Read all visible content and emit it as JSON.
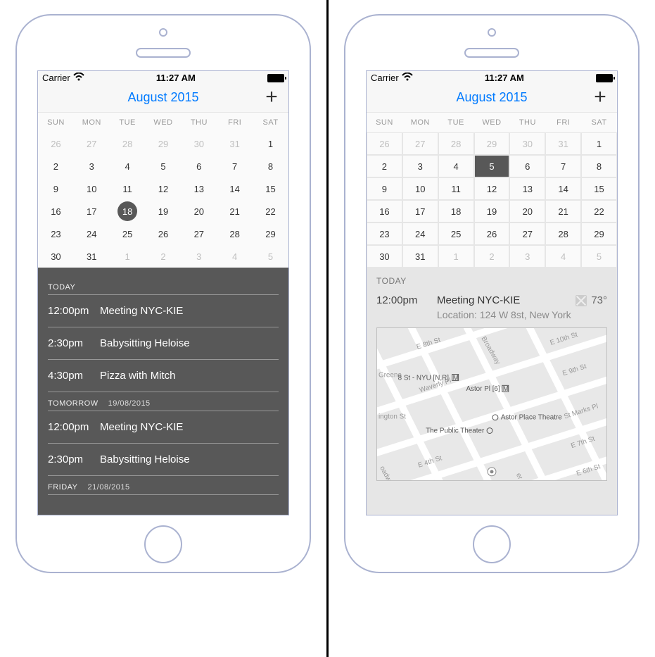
{
  "statusbar": {
    "carrier": "Carrier",
    "time": "11:27 AM"
  },
  "header": {
    "title": "August 2015"
  },
  "weekdays": [
    "SUN",
    "MON",
    "TUE",
    "WED",
    "THU",
    "FRI",
    "SAT"
  ],
  "calendar_left": {
    "selected_day": 18,
    "days": [
      {
        "n": 26,
        "other": true
      },
      {
        "n": 27,
        "other": true
      },
      {
        "n": 28,
        "other": true
      },
      {
        "n": 29,
        "other": true
      },
      {
        "n": 30,
        "other": true
      },
      {
        "n": 31,
        "other": true
      },
      {
        "n": 1
      },
      {
        "n": 2
      },
      {
        "n": 3
      },
      {
        "n": 4
      },
      {
        "n": 5
      },
      {
        "n": 6
      },
      {
        "n": 7
      },
      {
        "n": 8
      },
      {
        "n": 9
      },
      {
        "n": 10
      },
      {
        "n": 11
      },
      {
        "n": 12
      },
      {
        "n": 13
      },
      {
        "n": 14
      },
      {
        "n": 15
      },
      {
        "n": 16
      },
      {
        "n": 17
      },
      {
        "n": 18
      },
      {
        "n": 19
      },
      {
        "n": 20
      },
      {
        "n": 21
      },
      {
        "n": 22
      },
      {
        "n": 23
      },
      {
        "n": 24
      },
      {
        "n": 25
      },
      {
        "n": 26
      },
      {
        "n": 27
      },
      {
        "n": 28
      },
      {
        "n": 29
      },
      {
        "n": 30
      },
      {
        "n": 31
      },
      {
        "n": 1,
        "other": true
      },
      {
        "n": 2,
        "other": true
      },
      {
        "n": 3,
        "other": true
      },
      {
        "n": 4,
        "other": true
      },
      {
        "n": 5,
        "other": true
      }
    ]
  },
  "calendar_right": {
    "selected_day": 5,
    "days": [
      {
        "n": 26,
        "other": true
      },
      {
        "n": 27,
        "other": true
      },
      {
        "n": 28,
        "other": true
      },
      {
        "n": 29,
        "other": true
      },
      {
        "n": 30,
        "other": true
      },
      {
        "n": 31,
        "other": true
      },
      {
        "n": 1
      },
      {
        "n": 2
      },
      {
        "n": 3
      },
      {
        "n": 4
      },
      {
        "n": 5
      },
      {
        "n": 6
      },
      {
        "n": 7
      },
      {
        "n": 8
      },
      {
        "n": 9
      },
      {
        "n": 10
      },
      {
        "n": 11
      },
      {
        "n": 12
      },
      {
        "n": 13
      },
      {
        "n": 14
      },
      {
        "n": 15
      },
      {
        "n": 16
      },
      {
        "n": 17
      },
      {
        "n": 18
      },
      {
        "n": 19
      },
      {
        "n": 20
      },
      {
        "n": 21
      },
      {
        "n": 22
      },
      {
        "n": 23
      },
      {
        "n": 24
      },
      {
        "n": 25
      },
      {
        "n": 26
      },
      {
        "n": 27
      },
      {
        "n": 28
      },
      {
        "n": 29
      },
      {
        "n": 30
      },
      {
        "n": 31
      },
      {
        "n": 1,
        "other": true
      },
      {
        "n": 2,
        "other": true
      },
      {
        "n": 3,
        "other": true
      },
      {
        "n": 4,
        "other": true
      },
      {
        "n": 5,
        "other": true
      }
    ]
  },
  "events_left": {
    "sections": [
      {
        "label": "TODAY",
        "date": "",
        "rows": [
          {
            "time": "12:00pm",
            "title": "Meeting NYC-KIE"
          },
          {
            "time": "2:30pm",
            "title": "Babysitting Heloise"
          },
          {
            "time": "4:30pm",
            "title": "Pizza with Mitch"
          }
        ]
      },
      {
        "label": "TOMORROW",
        "date": "19/08/2015",
        "rows": [
          {
            "time": "12:00pm",
            "title": "Meeting NYC-KIE"
          },
          {
            "time": "2:30pm",
            "title": "Babysitting Heloise"
          }
        ]
      },
      {
        "label": "FRIDAY",
        "date": "21/08/2015",
        "rows": []
      }
    ]
  },
  "detail_right": {
    "section_label": "TODAY",
    "time": "12:00pm",
    "title": "Meeting NYC-KIE",
    "weather": "73°",
    "location": "Location: 124 W 8st, New York",
    "map": {
      "streets": [
        "E 8th St",
        "Broadway",
        "E 10th St",
        "E 9th St",
        "Waverly Pl",
        "St Marks Pl",
        "E 7th St",
        "E 4th St",
        "ington St",
        "E 6th St",
        "oadway",
        "Greene",
        "er Sq"
      ],
      "pois": [
        {
          "name": "8 St - NYU [N,R]",
          "metro": true
        },
        {
          "name": "Astor Pl [6]",
          "metro": true
        },
        {
          "name": "Astor Place Theatre",
          "metro": false
        },
        {
          "name": "The Public Theater",
          "metro": false
        }
      ]
    }
  }
}
